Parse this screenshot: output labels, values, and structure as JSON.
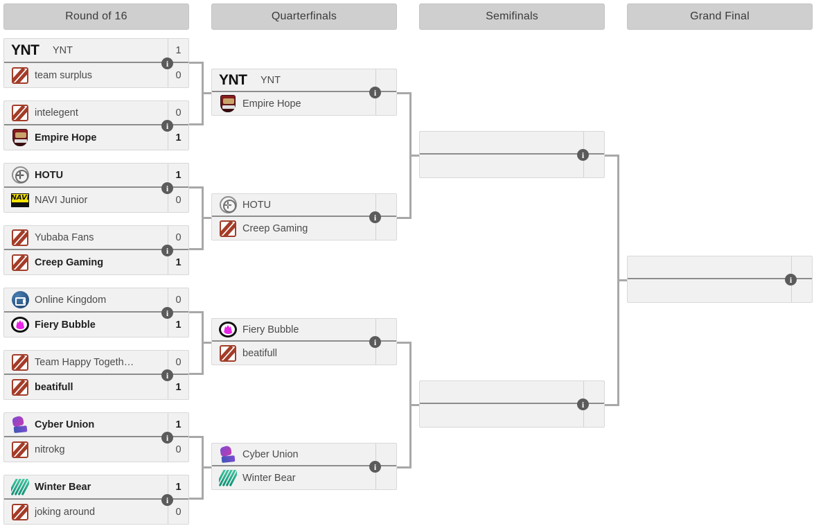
{
  "rounds": [
    {
      "label": "Round of 16"
    },
    {
      "label": "Quarterfinals"
    },
    {
      "label": "Semifinals"
    },
    {
      "label": "Grand Final"
    }
  ],
  "info_glyph": "i",
  "r16": [
    {
      "top": {
        "team": "YNT",
        "score": "1",
        "winner": true,
        "logo": "ynt"
      },
      "bottom": {
        "team": "team surplus",
        "score": "0",
        "winner": false,
        "logo": "dota"
      }
    },
    {
      "top": {
        "team": "intelegent",
        "score": "0",
        "winner": false,
        "logo": "dota"
      },
      "bottom": {
        "team": "Empire Hope",
        "score": "1",
        "winner": true,
        "logo": "empire"
      }
    },
    {
      "top": {
        "team": "HOTU",
        "score": "1",
        "winner": true,
        "logo": "hotu"
      },
      "bottom": {
        "team": "NAVI Junior",
        "score": "0",
        "winner": false,
        "logo": "navi"
      }
    },
    {
      "top": {
        "team": "Yubaba Fans",
        "score": "0",
        "winner": false,
        "logo": "dota"
      },
      "bottom": {
        "team": "Creep Gaming",
        "score": "1",
        "winner": true,
        "logo": "dota"
      }
    },
    {
      "top": {
        "team": "Online Kingdom",
        "score": "0",
        "winner": false,
        "logo": "ok"
      },
      "bottom": {
        "team": "Fiery Bubble",
        "score": "1",
        "winner": true,
        "logo": "fiery"
      }
    },
    {
      "top": {
        "team": "Team Happy Togeth…",
        "score": "0",
        "winner": false,
        "logo": "dota"
      },
      "bottom": {
        "team": "beatifull",
        "score": "1",
        "winner": true,
        "logo": "dota"
      }
    },
    {
      "top": {
        "team": "Cyber Union",
        "score": "1",
        "winner": true,
        "logo": "cyber"
      },
      "bottom": {
        "team": "nitrokg",
        "score": "0",
        "winner": false,
        "logo": "dota"
      }
    },
    {
      "top": {
        "team": "Winter Bear",
        "score": "1",
        "winner": true,
        "logo": "winter"
      },
      "bottom": {
        "team": "joking around",
        "score": "0",
        "winner": false,
        "logo": "dota"
      }
    }
  ],
  "quarterfinals": [
    {
      "top": {
        "team": "YNT",
        "score": "",
        "winner": false,
        "logo": "ynt"
      },
      "bottom": {
        "team": "Empire Hope",
        "score": "",
        "winner": false,
        "logo": "empire"
      }
    },
    {
      "top": {
        "team": "HOTU",
        "score": "",
        "winner": false,
        "logo": "hotu"
      },
      "bottom": {
        "team": "Creep Gaming",
        "score": "",
        "winner": false,
        "logo": "dota"
      }
    },
    {
      "top": {
        "team": "Fiery Bubble",
        "score": "",
        "winner": false,
        "logo": "fiery"
      },
      "bottom": {
        "team": "beatifull",
        "score": "",
        "winner": false,
        "logo": "dota"
      }
    },
    {
      "top": {
        "team": "Cyber Union",
        "score": "",
        "winner": false,
        "logo": "cyber"
      },
      "bottom": {
        "team": "Winter Bear",
        "score": "",
        "winner": false,
        "logo": "winter"
      }
    }
  ],
  "semifinals": [
    {
      "top": {
        "team": "",
        "score": "",
        "winner": false,
        "logo": "none"
      },
      "bottom": {
        "team": "",
        "score": "",
        "winner": false,
        "logo": "none"
      }
    },
    {
      "top": {
        "team": "",
        "score": "",
        "winner": false,
        "logo": "none"
      },
      "bottom": {
        "team": "",
        "score": "",
        "winner": false,
        "logo": "none"
      }
    }
  ],
  "grand_final": [
    {
      "top": {
        "team": "",
        "score": "",
        "winner": false,
        "logo": "none"
      },
      "bottom": {
        "team": "",
        "score": "",
        "winner": false,
        "logo": "none"
      }
    }
  ],
  "colors": {
    "header_bg": "#cfcfcf",
    "match_bg": "#f1f1f1",
    "connector": "#a8a8a8",
    "info_badge": "#5b5b5b"
  }
}
